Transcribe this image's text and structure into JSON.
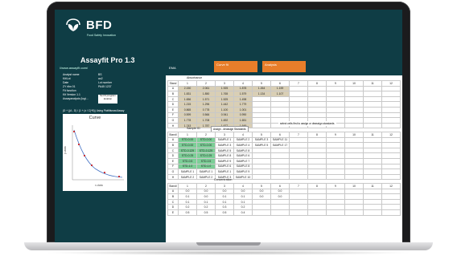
{
  "brand": {
    "name": "BFD",
    "tagline": "Food Safety Innovation"
  },
  "app": {
    "title": "Assayfit Pro 1.3",
    "url": "//www.assayfit.com/"
  },
  "info": [
    {
      "k": "Analyst name",
      "v": "BS"
    },
    {
      "k": "Kit/Lot",
      "v": "ao2"
    },
    {
      "k": "Date",
      "v": "Lot number"
    },
    {
      "k": "ZY rlbn 01",
      "v": "PA45 1237"
    },
    {
      "k": "Fit function",
      "v": ""
    },
    {
      "k": "Kit Version 1.1",
      "v": ""
    },
    {
      "k": "Assayanalysis (logi...",
      "v": ""
    }
  ],
  "note": "Set fit program location",
  "formula": "(D + ((A - D) / (1 + (x / C)^B)) Using Plotfitlsnow/Assay",
  "curve": {
    "title": "Curve",
    "ylabel": "y-data",
    "xlabel": "x-data"
  },
  "sheet": {
    "left_label": "EMA",
    "tabs": [
      {
        "label": "Curve fit"
      },
      {
        "label": "Analysis"
      }
    ],
    "absorbance_caption": "Absorbance",
    "col_headers": [
      "1",
      "2",
      "3",
      "4",
      "5",
      "6",
      "7",
      "8",
      "9",
      "10",
      "11",
      "12"
    ],
    "row_letters": [
      "A",
      "B",
      "C",
      "D",
      "E",
      "F",
      "G",
      "H"
    ],
    "absorbance": [
      [
        "2.150",
        "2.061",
        "1.925",
        "1.878",
        "1.264",
        "1.159"
      ],
      [
        "1.831",
        "1.850",
        "1.765",
        "1.579",
        "1.134",
        "1.107"
      ],
      [
        "1.656",
        "1.571",
        "1.525",
        "1.498",
        "",
        ""
      ],
      [
        "1.215",
        "1.296",
        "1.442",
        "1.779",
        "",
        ""
      ],
      [
        "0.865",
        "0.778",
        "1.100",
        "1.001",
        "",
        ""
      ],
      [
        "0.599",
        "0.566",
        "0.941",
        "0.990",
        "",
        ""
      ],
      [
        "1.778",
        "1.708",
        "1.692",
        "1.651",
        "",
        ""
      ],
      [
        "1.743",
        "1.787",
        "1.677",
        "1.649",
        "",
        ""
      ]
    ],
    "sample_caption": "Sample ID",
    "assign_button": "Assign - deassign Standards",
    "assign_hint": "select cells first to assign or deassign standards",
    "samples": [
      [
        "STD-0.00",
        "STD-0.00",
        "SAMPLE 1",
        "SAMPLE 2",
        "SAMPLE 3",
        "SAMPLE 11"
      ],
      [
        "STD-0.00",
        "STD-0.00",
        "SAMPLE 3",
        "SAMPLE 4",
        "SAMPLE 5",
        "SAMPLE 17"
      ],
      [
        "STD-0.129",
        "STD-0.129",
        "SAMPLE 5",
        "SAMPLE 8",
        "",
        ""
      ],
      [
        "STD-0.25",
        "STD-0.25",
        "SAMPLE 8",
        "SAMPLE 6",
        "",
        ""
      ],
      [
        "STD-0.5",
        "STD-0.5",
        "SAMPLE 9",
        "SAMPLE 7",
        "",
        ""
      ],
      [
        "STD-1.0",
        "STD-1.0",
        "SAMPLE 6",
        "SAMPLE 8",
        "",
        ""
      ],
      [
        "SAMPLE 1",
        "SAMPLE 1",
        "SAMPLE 1",
        "SAMPLE 9",
        "",
        ""
      ],
      [
        "SAMPLE 2",
        "SAMPLE 2",
        "SAMPLE 3",
        "SAMPLE 10",
        "",
        ""
      ]
    ],
    "conc_caption": "Concentration",
    "concentration": [
      [
        "0.0",
        "0.0",
        "0.0",
        "0.0",
        "0.0",
        "0.0"
      ],
      [
        "0.1",
        "0.0",
        "0.1",
        "0.1",
        "0.0",
        "0.0"
      ],
      [
        "0.1",
        "0.1",
        "0.1",
        "0.1",
        "",
        ""
      ],
      [
        "0.2",
        "0.2",
        "0.3",
        "0.2",
        "",
        ""
      ],
      [
        "0.5",
        "0.5",
        "0.5",
        "0.4",
        "",
        ""
      ]
    ]
  },
  "colors": {
    "panel": "#0f3d45",
    "accent": "#e87e2a",
    "standard_fill": "#7ccf97",
    "absorbance_fill": "#d9cfb5"
  }
}
